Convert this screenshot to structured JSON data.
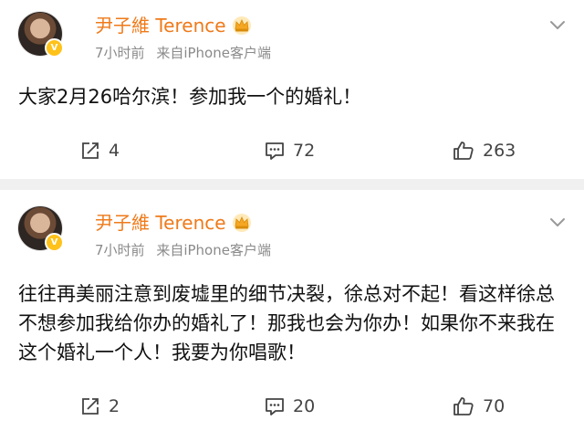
{
  "posts": [
    {
      "author": "尹子維 Terence",
      "time": "7小时前",
      "source": "来自iPhone客户端",
      "text": "大家2月26哈尔滨！参加我一个的婚礼！",
      "reposts": "4",
      "comments": "72",
      "likes": "263"
    },
    {
      "author": "尹子維 Terence",
      "time": "7小时前",
      "source": "来自iPhone客户端",
      "text": "往往再美丽注意到废墟里的细节决裂，徐总对不起！看这样徐总不想参加我给你办的婚礼了！那我也会为你办！如果你不来我在这个婚礼一个人！我要为你唱歌！",
      "reposts": "2",
      "comments": "20",
      "likes": "70"
    }
  ],
  "colors": {
    "author_name": "#ef7a1a",
    "verified_badge": "#ffc21a",
    "meta_text": "#8a8a8a",
    "separator": "#f0f0f0"
  },
  "icons": {
    "verified": "v-badge-icon",
    "crown": "crown-icon",
    "more": "chevron-down-icon",
    "repost": "repost-icon",
    "comment": "comment-icon",
    "like": "thumbs-up-icon"
  }
}
